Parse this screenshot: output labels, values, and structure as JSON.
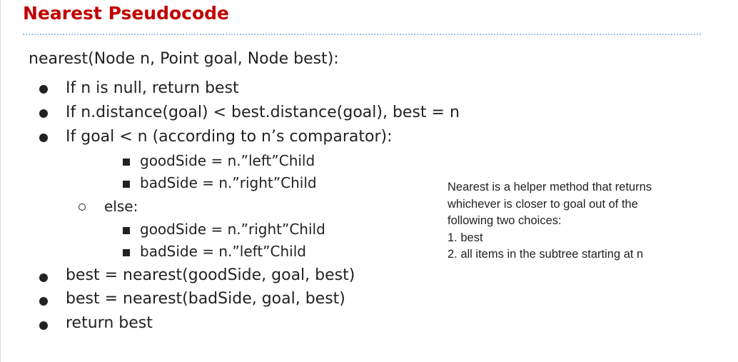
{
  "slide": {
    "title": "Nearest Pseudocode",
    "signature": "nearest(Node n, Point goal, Node best):",
    "steps": [
      "If n is null, return best",
      "If n.distance(goal) < best.distance(goal), best = n",
      "If goal < n (according to n’s comparator):"
    ],
    "if_branch": [
      "goodSide = n.”left”Child",
      "badSide = n.”right”Child"
    ],
    "else_label": "else:",
    "else_branch": [
      "goodSide = n.”right”Child",
      "badSide = n.”left”Child"
    ],
    "final_steps": [
      "best = nearest(goodSide, goal, best)",
      "best = nearest(badSide, goal, best)",
      "return best"
    ],
    "note_lines": [
      "Nearest is a helper method that returns",
      "whichever is closer to goal out of the",
      "following two choices:",
      "1. best",
      "2. all items in the subtree starting at n"
    ]
  }
}
